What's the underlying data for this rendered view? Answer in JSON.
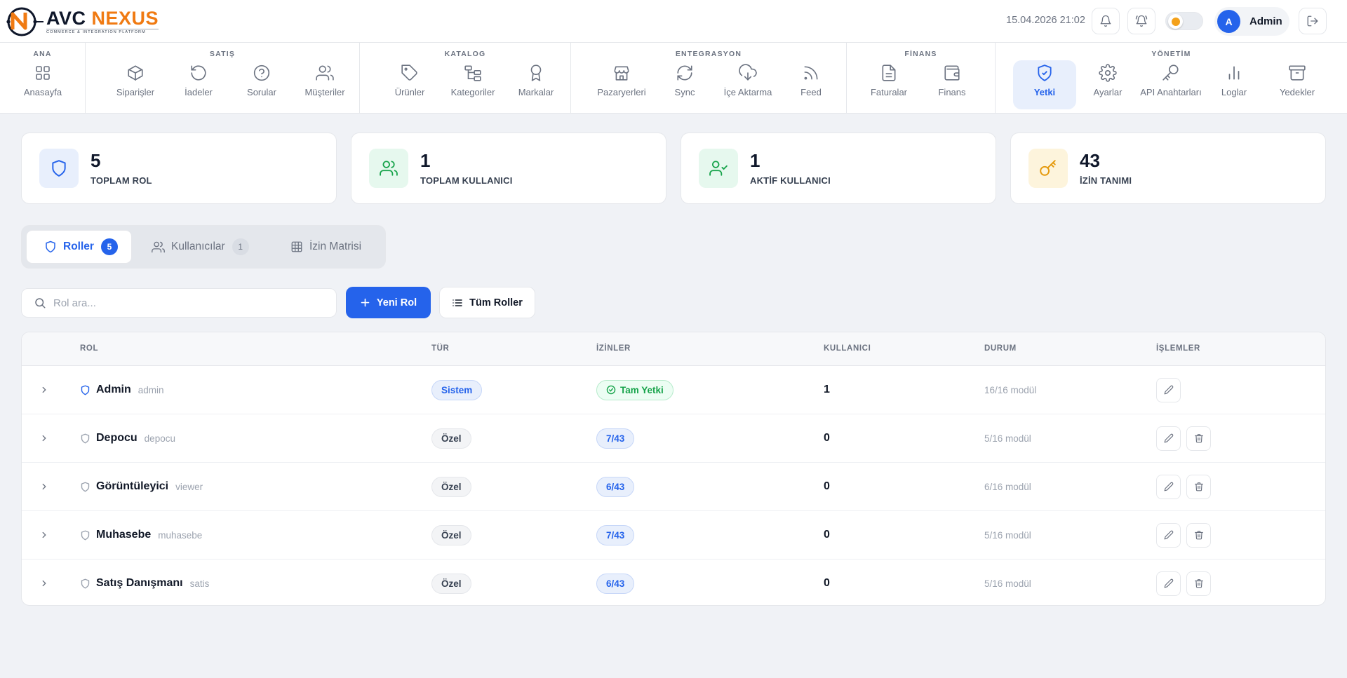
{
  "app": {
    "logo_avc": "AVC",
    "logo_nexus": "NEXUS",
    "logo_tagline": "COMMERCE & INTEGRATION PLATFORM",
    "brand_color": "#f07a12",
    "accent_color": "#2563eb"
  },
  "header": {
    "datetime": "15.04.2026 21:02",
    "user_initial": "A",
    "user_name": "Admin",
    "icons": [
      "bell-icon",
      "alert-bell-icon",
      "theme-toggle",
      "logout-icon"
    ]
  },
  "nav": {
    "groups": [
      {
        "title": "ANA",
        "items": [
          {
            "label": "Anasayfa",
            "icon": "grid-icon"
          }
        ]
      },
      {
        "title": "SATIŞ",
        "items": [
          {
            "label": "Siparişler",
            "icon": "box-icon"
          },
          {
            "label": "İadeler",
            "icon": "undo-icon"
          },
          {
            "label": "Sorular",
            "icon": "question-icon"
          },
          {
            "label": "Müşteriler",
            "icon": "users-icon"
          }
        ]
      },
      {
        "title": "KATALOG",
        "items": [
          {
            "label": "Ürünler",
            "icon": "tag-icon"
          },
          {
            "label": "Kategoriler",
            "icon": "tree-icon"
          },
          {
            "label": "Markalar",
            "icon": "award-icon"
          }
        ]
      },
      {
        "title": "ENTEGRASYON",
        "items": [
          {
            "label": "Pazaryerleri",
            "icon": "store-icon"
          },
          {
            "label": "Sync",
            "icon": "refresh-icon"
          },
          {
            "label": "İçe Aktarma",
            "icon": "cloud-download-icon"
          },
          {
            "label": "Feed",
            "icon": "rss-icon"
          }
        ]
      },
      {
        "title": "FİNANS",
        "items": [
          {
            "label": "Faturalar",
            "icon": "file-text-icon"
          },
          {
            "label": "Finans",
            "icon": "wallet-icon"
          }
        ]
      },
      {
        "title": "YÖNETİM",
        "items": [
          {
            "label": "Yetki",
            "icon": "shield-check-icon",
            "active": true
          },
          {
            "label": "Ayarlar",
            "icon": "gear-icon"
          },
          {
            "label": "API Anahtarları",
            "icon": "key-icon"
          },
          {
            "label": "Loglar",
            "icon": "bar-chart-icon"
          },
          {
            "label": "Yedekler",
            "icon": "archive-icon"
          }
        ]
      }
    ]
  },
  "stats": [
    {
      "value": "5",
      "label": "TOPLAM ROL",
      "icon": "shield-icon",
      "color": "#2563eb",
      "bg": "#e8effc"
    },
    {
      "value": "1",
      "label": "TOPLAM KULLANICI",
      "icon": "users-icon",
      "color": "#16a34a",
      "bg": "#e6f8ee"
    },
    {
      "value": "1",
      "label": "AKTİF KULLANICI",
      "icon": "user-check-icon",
      "color": "#16a34a",
      "bg": "#e6f8ee"
    },
    {
      "value": "43",
      "label": "İZİN TANIMI",
      "icon": "key-icon",
      "color": "#e59a0e",
      "bg": "#fdf4dc"
    }
  ],
  "tabs": [
    {
      "label": "Roller",
      "count": "5",
      "active": true
    },
    {
      "label": "Kullanıcılar",
      "count": "1",
      "active": false
    },
    {
      "label": "İzin Matrisi",
      "active": false
    }
  ],
  "toolbar": {
    "search_placeholder": "Rol ara...",
    "new_role_label": "Yeni Rol",
    "all_roles_label": "Tüm Roller"
  },
  "table": {
    "headers": {
      "role": "ROL",
      "type": "TÜR",
      "perms": "İZİNLER",
      "users": "KULLANICI",
      "status": "DURUM",
      "actions": "İŞLEMLER"
    },
    "rows": [
      {
        "name": "Admin",
        "slug": "admin",
        "type": "Sistem",
        "perms": "Tam Yetki",
        "users": "1",
        "status": "16/16 modül",
        "system": true
      },
      {
        "name": "Depocu",
        "slug": "depocu",
        "type": "Özel",
        "perms": "7/43",
        "users": "0",
        "status": "5/16 modül",
        "system": false
      },
      {
        "name": "Görüntüleyici",
        "slug": "viewer",
        "type": "Özel",
        "perms": "6/43",
        "users": "0",
        "status": "6/16 modül",
        "system": false
      },
      {
        "name": "Muhasebe",
        "slug": "muhasebe",
        "type": "Özel",
        "perms": "7/43",
        "users": "0",
        "status": "5/16 modül",
        "system": false
      },
      {
        "name": "Satış Danışmanı",
        "slug": "satis",
        "type": "Özel",
        "perms": "6/43",
        "users": "0",
        "status": "5/16 modül",
        "system": false
      }
    ]
  }
}
